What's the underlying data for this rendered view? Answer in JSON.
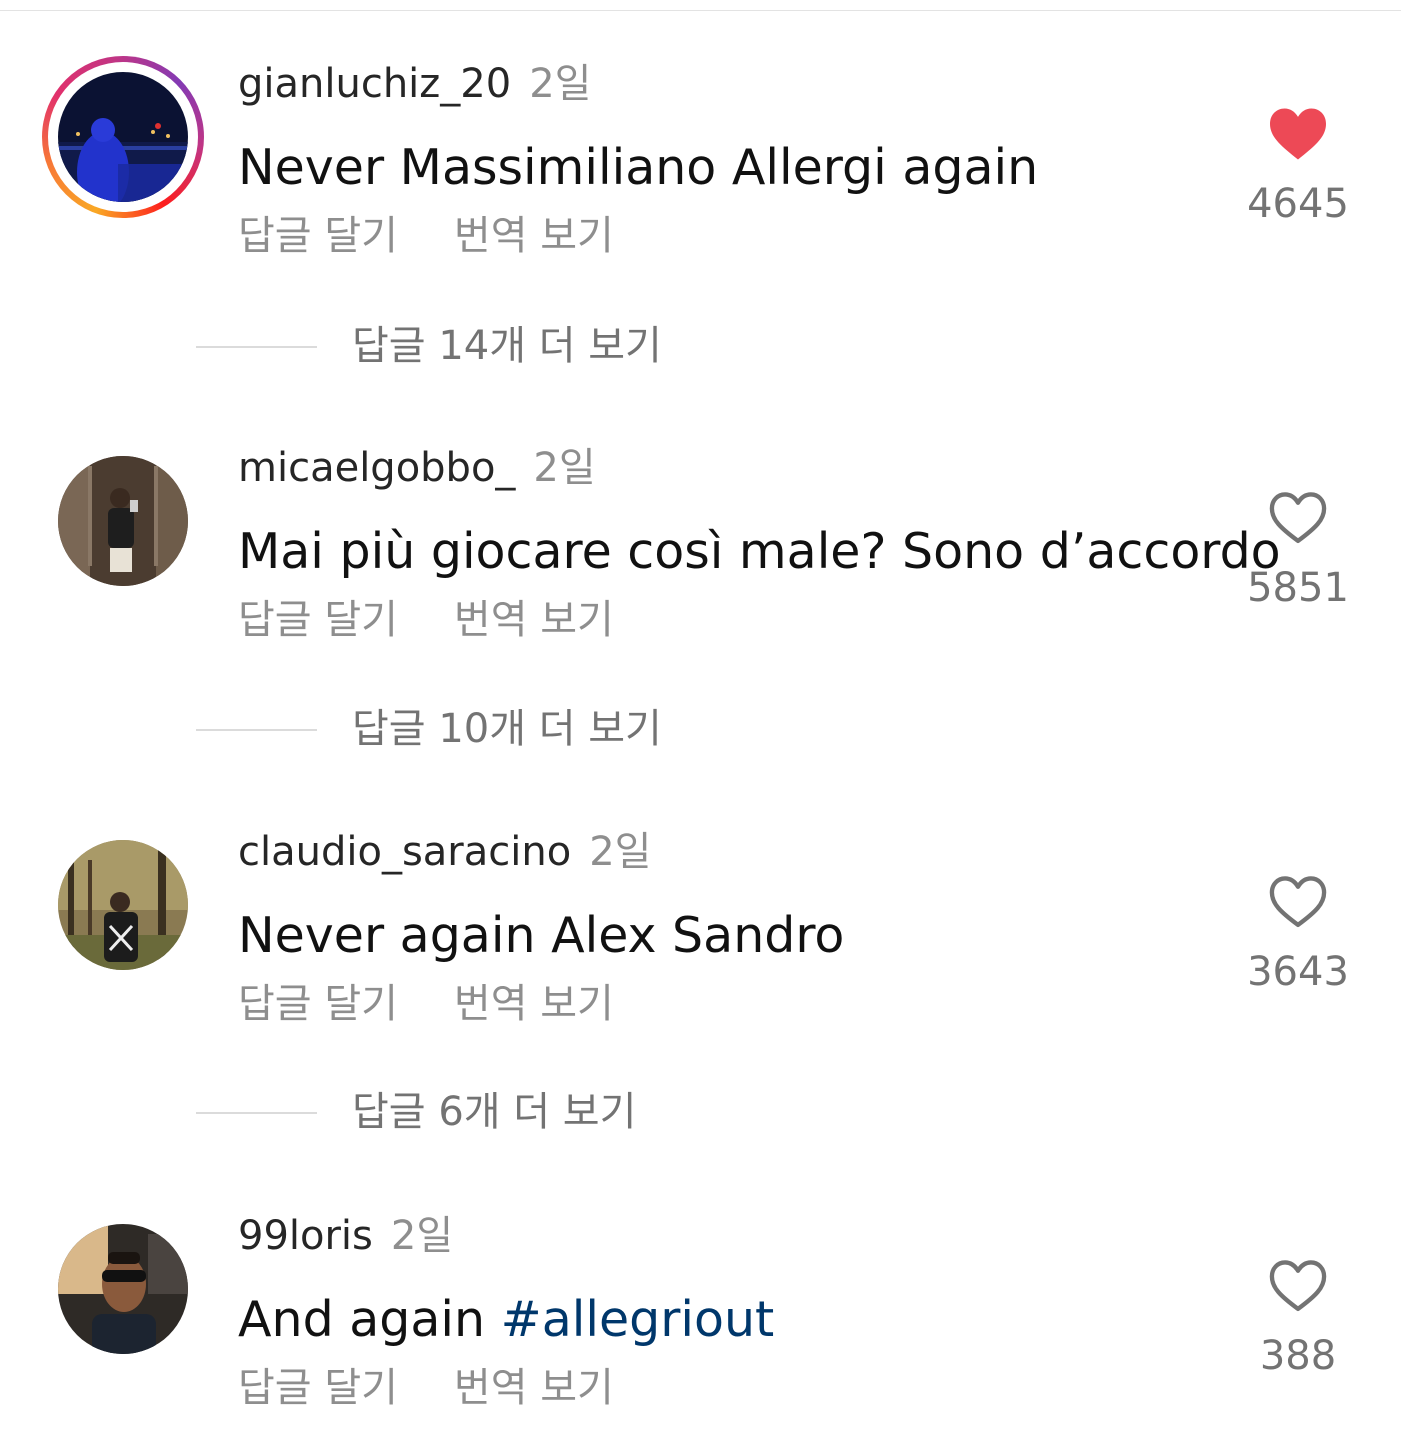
{
  "comments": [
    {
      "username": "gianluchiz_20",
      "time": "2일",
      "text": "Never Massimiliano Allergi again",
      "reply_label": "답글 달기",
      "translate_label": "번역 보기",
      "likes": "4645",
      "liked": true,
      "story_ring": true,
      "view_replies": "답글 14개 더 보기"
    },
    {
      "username": "micaelgobbo_",
      "time": "2일",
      "text": "Mai più giocare così male? Sono d’accordo",
      "reply_label": "답글 달기",
      "translate_label": "번역 보기",
      "likes": "5851",
      "liked": false,
      "story_ring": false,
      "view_replies": "답글 10개 더 보기"
    },
    {
      "username": "claudio_saracino",
      "time": "2일",
      "text": "Never again Alex Sandro",
      "reply_label": "답글 달기",
      "translate_label": "번역 보기",
      "likes": "3643",
      "liked": false,
      "story_ring": false,
      "view_replies": "답글 6개 더 보기"
    },
    {
      "username": "99loris",
      "time": "2일",
      "text": "And again ",
      "hashtag": "#allegriout",
      "reply_label": "답글 달기",
      "translate_label": "번역 보기",
      "likes": "388",
      "liked": false,
      "story_ring": false
    }
  ],
  "colors": {
    "liked_heart": "#ed4956",
    "hashtag": "#00376b",
    "secondary_text": "#8e8e8e"
  },
  "icons": {
    "liked": "heart-filled-icon",
    "unliked": "heart-outline-icon"
  }
}
